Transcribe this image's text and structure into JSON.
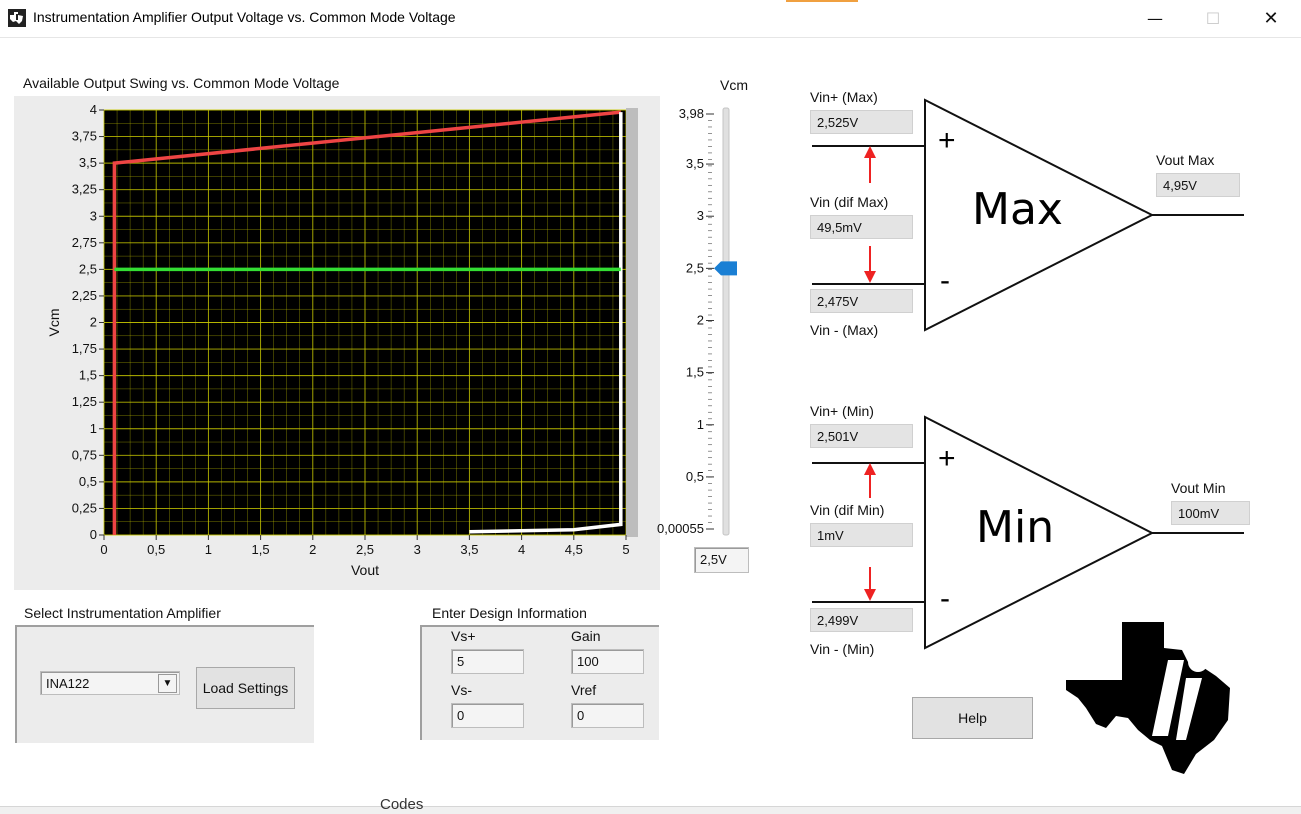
{
  "window": {
    "title": "Instrumentation Amplifier Output Voltage vs. Common Mode Voltage",
    "minimize": "—",
    "maximize": "☐",
    "close": "✕"
  },
  "chart_data": {
    "type": "line",
    "title": "Available Output Swing vs. Common Mode Voltage",
    "xlabel": "Vout",
    "ylabel": "Vcm",
    "xlim": [
      0,
      5
    ],
    "ylim": [
      0,
      4
    ],
    "x_ticks": [
      "0",
      "0,5",
      "1",
      "1,5",
      "2",
      "2,5",
      "3",
      "3,5",
      "4",
      "4,5",
      "5"
    ],
    "y_ticks": [
      "0",
      "0,25",
      "0,5",
      "0,75",
      "1",
      "1,25",
      "1,5",
      "1,75",
      "2",
      "2,25",
      "2,5",
      "2,75",
      "3",
      "3,25",
      "3,5",
      "3,75",
      "4"
    ],
    "grid": true,
    "series": [
      {
        "color": "#ee4444",
        "points": [
          [
            0.1,
            0
          ],
          [
            0.1,
            3.5
          ],
          [
            4.95,
            3.98
          ]
        ]
      },
      {
        "color": "#ffffff",
        "points": [
          [
            3.5,
            0.03
          ],
          [
            4.5,
            0.05
          ],
          [
            4.95,
            0.1
          ],
          [
            4.95,
            3.98
          ]
        ]
      },
      {
        "color": "#33dd33",
        "points": [
          [
            0.1,
            2.5
          ],
          [
            4.95,
            2.5
          ]
        ]
      }
    ]
  },
  "vcm_slider": {
    "label": "Vcm",
    "ticks": [
      "3,98",
      "3,5",
      "3",
      "2,5",
      "2",
      "1,5",
      "1",
      "0,5",
      "0,00055"
    ],
    "tick_values": [
      3.98,
      3.5,
      3,
      2.5,
      2,
      1.5,
      1,
      0.5,
      0.00055
    ],
    "min": 0.00055,
    "max": 3.98,
    "value": 2.5,
    "readout": "2,5V"
  },
  "amp_max": {
    "label": "Max",
    "vin_plus_label": "Vin+ (Max)",
    "vin_plus": "2,525V",
    "vin_dif_label": "Vin (dif Max)",
    "vin_dif": "49,5mV",
    "vin_minus": "2,475V",
    "vin_minus_label": "Vin - (Max)",
    "vout_label": "Vout Max",
    "vout": "4,95V",
    "plus_sign": "+",
    "minus_sign": "-"
  },
  "amp_min": {
    "label": "Min",
    "vin_plus_label": "Vin+ (Min)",
    "vin_plus": "2,501V",
    "vin_dif_label": "Vin (dif Min)",
    "vin_dif": "1mV",
    "vin_minus": "2,499V",
    "vin_minus_label": "Vin - (Min)",
    "vout_label": "Vout Min",
    "vout": "100mV",
    "plus_sign": "+",
    "minus_sign": "-"
  },
  "amp_select": {
    "label": "Select Instrumentation Amplifier",
    "value": "INA122",
    "load_button": "Load Settings"
  },
  "design": {
    "label": "Enter Design Information",
    "vs_plus_label": "Vs+",
    "vs_plus": "5",
    "gain_label": "Gain",
    "gain": "100",
    "vs_minus_label": "Vs-",
    "vs_minus": "0",
    "vref_label": "Vref",
    "vref": "0"
  },
  "help_button": "Help",
  "background_text": "Codes",
  "colors": {
    "plot_bg": "#000000",
    "grid": "#c8c800",
    "slider_thumb": "#1a7fd4",
    "arrow": "#ee2222"
  }
}
